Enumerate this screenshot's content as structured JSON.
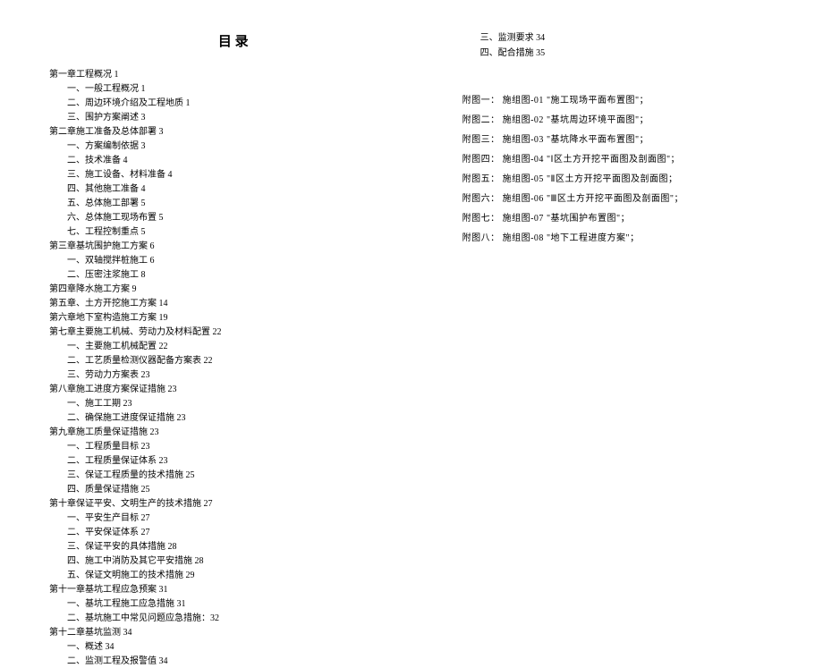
{
  "title": "目 录",
  "left_column": [
    {
      "type": "chapter",
      "text": "第一章工程概况 1"
    },
    {
      "type": "sub",
      "text": "一、一般工程概况 1"
    },
    {
      "type": "sub",
      "text": "二、周边环境介绍及工程地质 1"
    },
    {
      "type": "sub",
      "text": "三、围护方案阐述 3"
    },
    {
      "type": "chapter",
      "text": "第二章施工准备及总体部署 3"
    },
    {
      "type": "sub",
      "text": "一、方案编制依据 3"
    },
    {
      "type": "sub",
      "text": "二、技术准备 4"
    },
    {
      "type": "sub",
      "text": "三、施工设备、材料准备 4"
    },
    {
      "type": "sub",
      "text": "四、其他施工准备 4"
    },
    {
      "type": "sub",
      "text": "五、总体施工部署 5"
    },
    {
      "type": "sub",
      "text": "六、总体施工现场布置 5"
    },
    {
      "type": "sub",
      "text": "七、工程控制重点 5"
    },
    {
      "type": "chapter",
      "text": "第三章基坑围护施工方案 6"
    },
    {
      "type": "sub",
      "text": "一、双轴搅拌桩施工 6"
    },
    {
      "type": "sub",
      "text": "二、压密注浆施工 8"
    },
    {
      "type": "chapter",
      "text": "第四章降水施工方案 9"
    },
    {
      "type": "chapter",
      "text": "第五章、土方开挖施工方案 14"
    },
    {
      "type": "chapter",
      "text": "第六章地下室构造施工方案 19"
    },
    {
      "type": "chapter",
      "text": "第七章主要施工机械、劳动力及材料配置 22"
    },
    {
      "type": "sub",
      "text": "一、主要施工机械配置 22"
    },
    {
      "type": "sub",
      "text": "二、工艺质量检测仪器配备方案表 22"
    },
    {
      "type": "sub",
      "text": "三、劳动力方案表 23"
    },
    {
      "type": "chapter",
      "text": "第八章施工进度方案保证措施 23"
    },
    {
      "type": "sub",
      "text": "一、施工工期 23"
    },
    {
      "type": "sub",
      "text": "二、确保施工进度保证措施 23"
    },
    {
      "type": "chapter",
      "text": "第九章施工质量保证措施 23"
    },
    {
      "type": "sub",
      "text": "一、工程质量目标 23"
    },
    {
      "type": "sub",
      "text": "二、工程质量保证体系 23"
    },
    {
      "type": "sub",
      "text": "三、保证工程质量的技术措施 25"
    },
    {
      "type": "sub",
      "text": "四、质量保证措施 25"
    },
    {
      "type": "chapter",
      "text": "第十章保证平安、文明生产的技术措施 27"
    },
    {
      "type": "sub",
      "text": "一、平安生产目标 27"
    },
    {
      "type": "sub",
      "text": "二、平安保证体系 27"
    },
    {
      "type": "sub",
      "text": "三、保证平安的具体措施 28"
    },
    {
      "type": "sub",
      "text": "四、施工中消防及其它平安措施 28"
    },
    {
      "type": "sub",
      "text": "五、保证文明施工的技术措施 29"
    },
    {
      "type": "chapter",
      "text": "第十一章基坑工程应急预案 31"
    },
    {
      "type": "sub",
      "text": "一、基坑工程施工应急措施 31"
    },
    {
      "type": "sub",
      "text": "二、基坑施工中常见问题应急措施：32"
    },
    {
      "type": "chapter",
      "text": "第十二章基坑监测 34"
    },
    {
      "type": "sub",
      "text": "一、概述 34"
    },
    {
      "type": "sub",
      "text": "二、监测工程及报警值 34"
    }
  ],
  "right_top": [
    {
      "type": "sub",
      "text": "三、监测要求 34"
    },
    {
      "type": "sub",
      "text": "四、配合措施 35"
    }
  ],
  "attachments": [
    {
      "label": "附图一：",
      "ref": "施组图-01",
      "title": "\"施工现场平面布置图\"；"
    },
    {
      "label": "附图二：",
      "ref": "施组图-02",
      "title": "\"基坑周边环境平面图\"；"
    },
    {
      "label": "附图三：",
      "ref": "施组图-03",
      "title": "\"基坑降水平面布置图\"；"
    },
    {
      "label": "附图四：",
      "ref": "施组图-04",
      "title": "\"Ⅰ区土方开挖平面图及剖面图\"；"
    },
    {
      "label": "附图五：",
      "ref": "施组图-05",
      "title": "\"Ⅱ区土方开挖平面图及剖面图；"
    },
    {
      "label": "附图六：",
      "ref": "施组图-06",
      "title": "\"Ⅲ区土方开挖平面图及剖面图\"；"
    },
    {
      "label": "附图七：",
      "ref": "施组图-07",
      "title": "\"基坑围护布置图\"；"
    },
    {
      "label": "附图八：",
      "ref": "施组图-08",
      "title": "\"地下工程进度方案\"；"
    }
  ]
}
